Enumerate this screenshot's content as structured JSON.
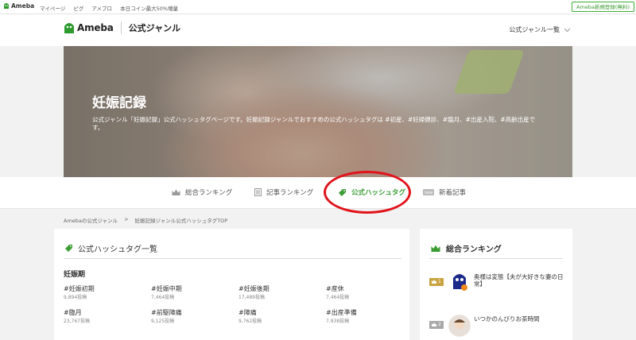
{
  "topbar": {
    "logo": "Ameba",
    "links": [
      "マイページ",
      "ピグ",
      "アメブロ",
      "本日コイン最大50%増量"
    ],
    "signup": "Ameba新規登録(無料)"
  },
  "header": {
    "brand": "Ameba",
    "genre_title": "公式ジャンル",
    "genre_list": "公式ジャンル一覧"
  },
  "hero": {
    "title": "妊娠記録",
    "description": "公式ジャンル「妊娠記録」公式ハッシュタグページです。妊娠記録ジャンルでおすすめの公式ハッシュタグは #初産、#妊婦健診、#臨月、#出産入院、#高齢出産です。"
  },
  "nav": {
    "tabs": [
      {
        "label": "総合ランキング",
        "icon": "crown-icon"
      },
      {
        "label": "記事ランキング",
        "icon": "document-icon"
      },
      {
        "label": "公式ハッシュタグ",
        "icon": "tag-icon"
      },
      {
        "label": "新着記事",
        "icon": "new-icon"
      }
    ]
  },
  "breadcrumb": {
    "root": "Amebaの公式ジャンル",
    "separator": ">",
    "current": "妊娠記録ジャンル公式ハッシュタグTOP"
  },
  "hashtags": {
    "heading": "公式ハッシュタグ一覧",
    "category": "妊娠期",
    "tags": [
      {
        "name": "#妊娠初期",
        "count": "9,894投稿"
      },
      {
        "name": "#妊娠中期",
        "count": "7,464投稿"
      },
      {
        "name": "#妊娠後期",
        "count": "17,489投稿"
      },
      {
        "name": "#産休",
        "count": "7,464投稿"
      },
      {
        "name": "#臨月",
        "count": "23,767投稿"
      },
      {
        "name": "#前駆陣痛",
        "count": "9,125投稿"
      },
      {
        "name": "#陣痛",
        "count": "9,762投稿"
      },
      {
        "name": "#出産準備",
        "count": "7,938投稿"
      }
    ]
  },
  "ranking": {
    "heading": "総合ランキング",
    "items": [
      {
        "rank": "1",
        "title": "奥様は変態【夫が大好きな妻の日常】"
      },
      {
        "rank": "2",
        "title": "いつかのんびりお茶時間"
      }
    ]
  },
  "colors": {
    "accent_green": "#3c9c34",
    "annotation_red": "#e2131b",
    "rank_gold": "#c8a23e"
  }
}
